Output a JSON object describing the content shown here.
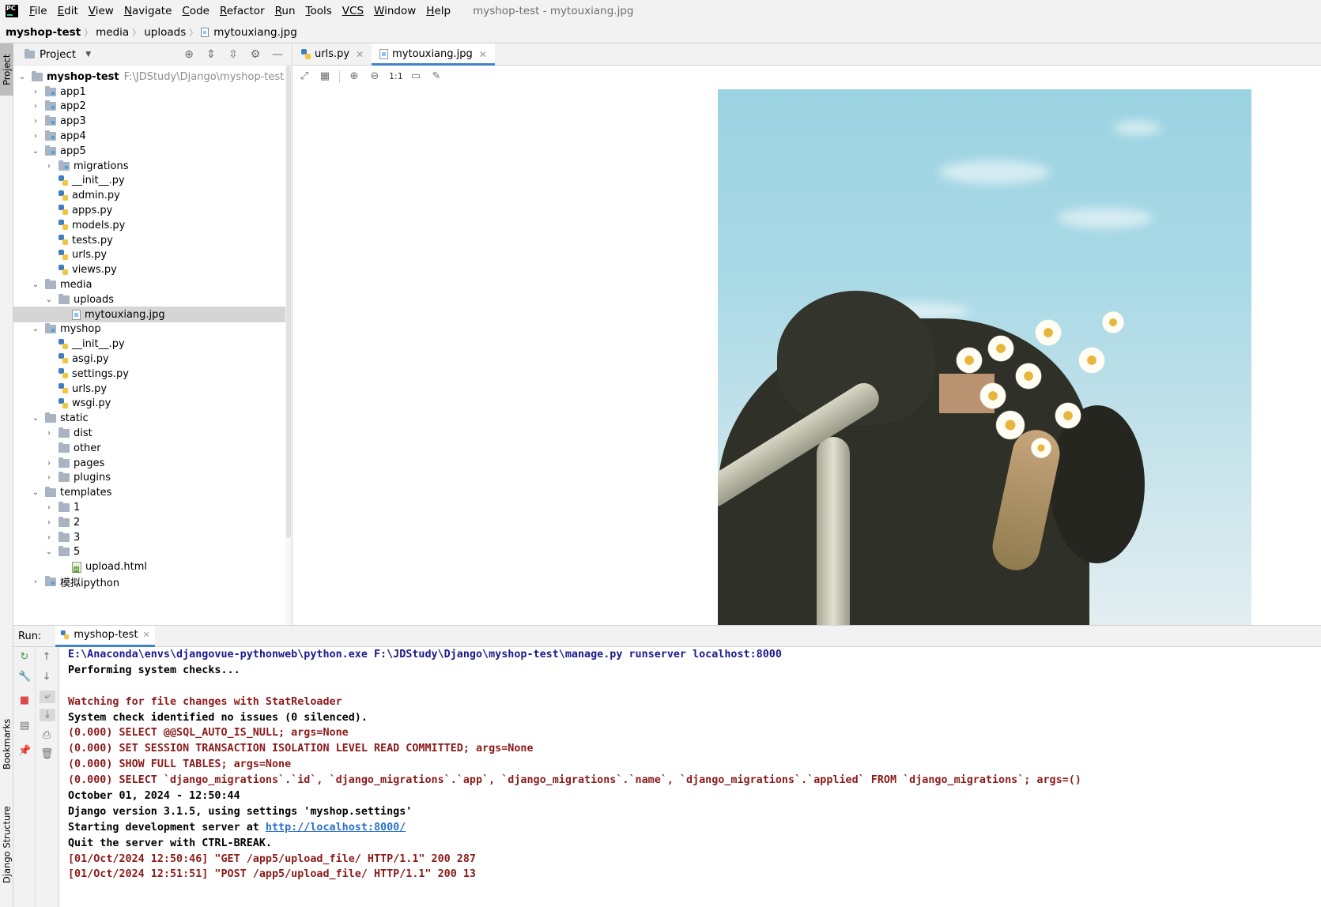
{
  "menubar": {
    "logo": "PC",
    "items": [
      {
        "ul": "F",
        "rest": "ile"
      },
      {
        "ul": "E",
        "rest": "dit"
      },
      {
        "ul": "V",
        "rest": "iew"
      },
      {
        "ul": "N",
        "rest": "avigate"
      },
      {
        "ul": "C",
        "rest": "ode"
      },
      {
        "ul": "R",
        "rest": "efactor"
      },
      {
        "ul": "R",
        "rest": "un"
      },
      {
        "ul": "T",
        "rest": "ools"
      },
      {
        "ul": "VCS",
        "rest": ""
      },
      {
        "ul": "W",
        "rest": "indow"
      },
      {
        "ul": "H",
        "rest": "elp"
      }
    ],
    "window_title": "myshop-test - mytouxiang.jpg"
  },
  "breadcrumb": [
    "myshop-test",
    "media",
    "uploads",
    "mytouxiang.jpg"
  ],
  "left_strip": {
    "project": "Project",
    "bookmarks": "Bookmarks",
    "structure": "Django Structure"
  },
  "project": {
    "title": "Project",
    "root_name": "myshop-test",
    "root_path": "F:\\JDStudy\\Django\\myshop-test",
    "tree": [
      {
        "label": "app1",
        "depth": 1,
        "type": "folder",
        "state": "collapsed",
        "mod": true
      },
      {
        "label": "app2",
        "depth": 1,
        "type": "folder",
        "state": "collapsed",
        "mod": true
      },
      {
        "label": "app3",
        "depth": 1,
        "type": "folder",
        "state": "collapsed",
        "mod": true
      },
      {
        "label": "app4",
        "depth": 1,
        "type": "folder",
        "state": "collapsed",
        "mod": true
      },
      {
        "label": "app5",
        "depth": 1,
        "type": "folder",
        "state": "expanded",
        "mod": true
      },
      {
        "label": "migrations",
        "depth": 2,
        "type": "folder",
        "state": "collapsed",
        "mod": true
      },
      {
        "label": "__init__.py",
        "depth": 2,
        "type": "py",
        "state": "none"
      },
      {
        "label": "admin.py",
        "depth": 2,
        "type": "py",
        "state": "none"
      },
      {
        "label": "apps.py",
        "depth": 2,
        "type": "py",
        "state": "none"
      },
      {
        "label": "models.py",
        "depth": 2,
        "type": "py",
        "state": "none"
      },
      {
        "label": "tests.py",
        "depth": 2,
        "type": "py",
        "state": "none"
      },
      {
        "label": "urls.py",
        "depth": 2,
        "type": "py",
        "state": "none"
      },
      {
        "label": "views.py",
        "depth": 2,
        "type": "py",
        "state": "none"
      },
      {
        "label": "media",
        "depth": 1,
        "type": "folder",
        "state": "expanded"
      },
      {
        "label": "uploads",
        "depth": 2,
        "type": "folder",
        "state": "expanded"
      },
      {
        "label": "mytouxiang.jpg",
        "depth": 3,
        "type": "img",
        "state": "none",
        "selected": true
      },
      {
        "label": "myshop",
        "depth": 1,
        "type": "folder",
        "state": "expanded",
        "mod": true
      },
      {
        "label": "__init__.py",
        "depth": 2,
        "type": "py",
        "state": "none"
      },
      {
        "label": "asgi.py",
        "depth": 2,
        "type": "py",
        "state": "none"
      },
      {
        "label": "settings.py",
        "depth": 2,
        "type": "py",
        "state": "none"
      },
      {
        "label": "urls.py",
        "depth": 2,
        "type": "py",
        "state": "none"
      },
      {
        "label": "wsgi.py",
        "depth": 2,
        "type": "py",
        "state": "none"
      },
      {
        "label": "static",
        "depth": 1,
        "type": "folder",
        "state": "expanded"
      },
      {
        "label": "dist",
        "depth": 2,
        "type": "folder",
        "state": "collapsed"
      },
      {
        "label": "other",
        "depth": 2,
        "type": "folder",
        "state": "none"
      },
      {
        "label": "pages",
        "depth": 2,
        "type": "folder",
        "state": "collapsed"
      },
      {
        "label": "plugins",
        "depth": 2,
        "type": "folder",
        "state": "collapsed"
      },
      {
        "label": "templates",
        "depth": 1,
        "type": "folder",
        "state": "expanded"
      },
      {
        "label": "1",
        "depth": 2,
        "type": "folder",
        "state": "collapsed"
      },
      {
        "label": "2",
        "depth": 2,
        "type": "folder",
        "state": "collapsed"
      },
      {
        "label": "3",
        "depth": 2,
        "type": "folder",
        "state": "collapsed"
      },
      {
        "label": "5",
        "depth": 2,
        "type": "folder",
        "state": "expanded"
      },
      {
        "label": "upload.html",
        "depth": 3,
        "type": "html",
        "state": "none"
      },
      {
        "label": "模拟ipython",
        "depth": 1,
        "type": "folder",
        "state": "collapsed",
        "mod": true
      }
    ]
  },
  "editor": {
    "tabs": [
      {
        "label": "urls.py",
        "icon": "python-file-icon",
        "active": false
      },
      {
        "label": "mytouxiang.jpg",
        "icon": "image-file-icon",
        "active": true
      }
    ],
    "image_toolbar": [
      "fit-to-screen-icon",
      "grid-icon",
      "zoom-in-icon",
      "zoom-out-icon",
      "actual-size-icon",
      "background-icon",
      "color-picker-icon"
    ],
    "actual_size_label": "1:1"
  },
  "run": {
    "label": "Run:",
    "tab_label": "myshop-test",
    "console": [
      {
        "text": "E:\\Anaconda\\envs\\djangovue-pythonweb\\python.exe F:\\JDStudy\\Django\\myshop-test\\manage.py runserver localhost:8000",
        "style": "cmd"
      },
      {
        "text": "Performing system checks...",
        "style": "black"
      },
      {
        "text": "",
        "style": "black"
      },
      {
        "text": "Watching for file changes with StatReloader",
        "style": "red"
      },
      {
        "text": "System check identified no issues (0 silenced).",
        "style": "black"
      },
      {
        "text": "(0.000) SELECT @@SQL_AUTO_IS_NULL; args=None",
        "style": "red"
      },
      {
        "text": "(0.000) SET SESSION TRANSACTION ISOLATION LEVEL READ COMMITTED; args=None",
        "style": "red"
      },
      {
        "text": "(0.000) SHOW FULL TABLES; args=None",
        "style": "red"
      },
      {
        "text": "(0.000) SELECT `django_migrations`.`id`, `django_migrations`.`app`, `django_migrations`.`name`, `django_migrations`.`applied` FROM `django_migrations`; args=()",
        "style": "red"
      },
      {
        "text": "October 01, 2024 - 12:50:44",
        "style": "black"
      },
      {
        "text": "Django version 3.1.5, using settings 'myshop.settings'",
        "style": "black"
      },
      {
        "text": "Starting development server at ",
        "style": "black",
        "link": "http://localhost:8000/"
      },
      {
        "text": "Quit the server with CTRL-BREAK.",
        "style": "black"
      },
      {
        "text": "[01/Oct/2024 12:50:46] \"GET /app5/upload_file/ HTTP/1.1\" 200 287",
        "style": "red"
      },
      {
        "text": "[01/Oct/2024 12:51:51] \"POST /app5/upload_file/ HTTP/1.1\" 200 13",
        "style": "red"
      }
    ]
  },
  "colors": {
    "accent": "#4083c9",
    "console_red": "#8b1a1a",
    "console_cmd": "#1a1a8c",
    "link": "#2a6fc9"
  }
}
